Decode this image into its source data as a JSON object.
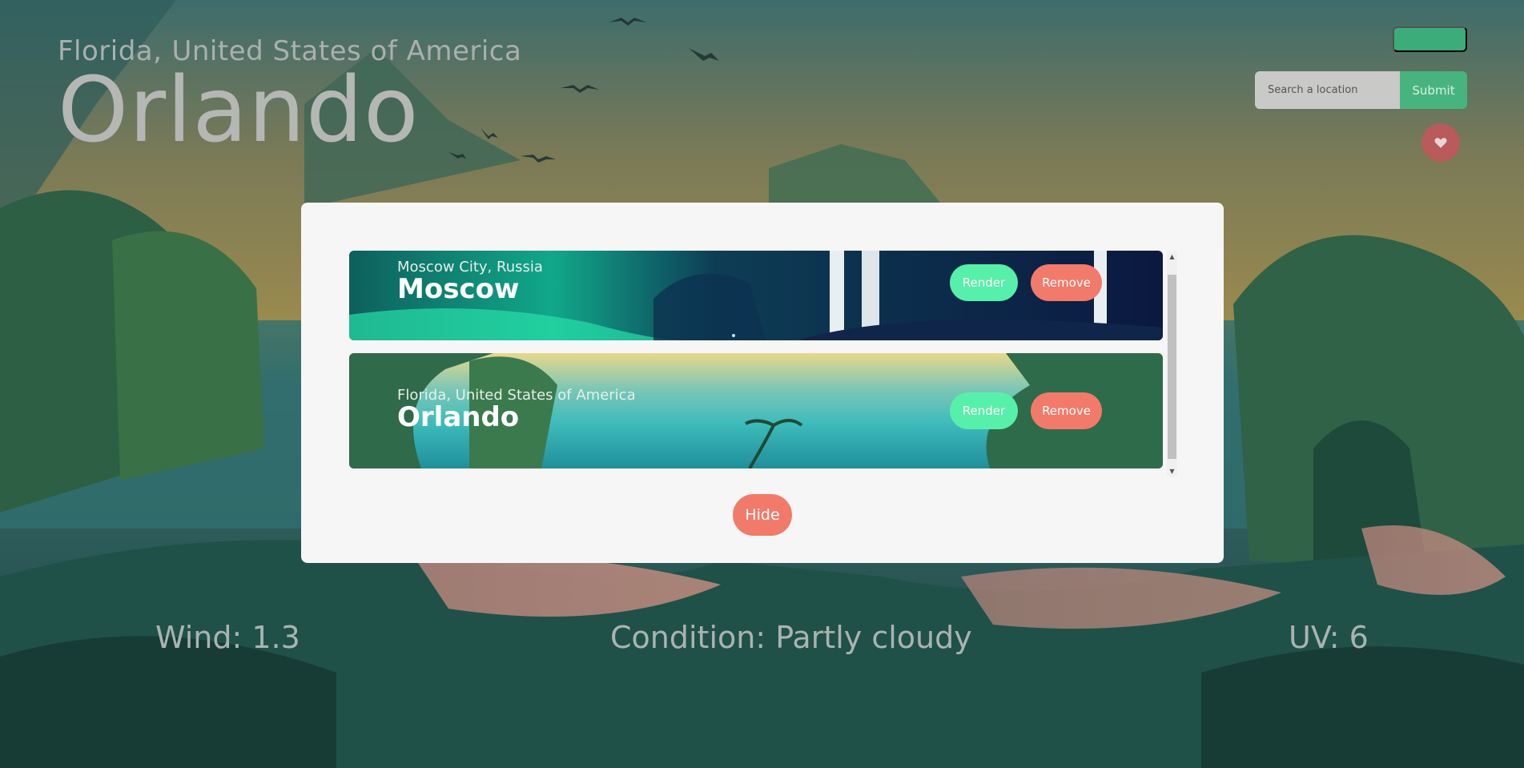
{
  "location": {
    "region": "Florida,",
    "country": "United States of America",
    "city": "Orlando"
  },
  "search": {
    "placeholder": "Search a location",
    "submit_label": "Submit"
  },
  "favorites": {
    "heart_icon": "heart-icon",
    "cards": [
      {
        "region": "Moscow City, Russia",
        "city": "Moscow",
        "render_label": "Render",
        "remove_label": "Remove"
      },
      {
        "region": "Florida, United States of America",
        "city": "Orlando",
        "render_label": "Render",
        "remove_label": "Remove"
      }
    ],
    "hide_label": "Hide"
  },
  "stats": {
    "wind": "Wind: 1.3",
    "condition": "Condition: Partly cloudy",
    "uv": "UV: 6"
  },
  "colors": {
    "accent_green": "#47b47f",
    "render_green": "#57f0aa",
    "remove_coral": "#f27a6a",
    "heart_red": "#b95b5b"
  }
}
